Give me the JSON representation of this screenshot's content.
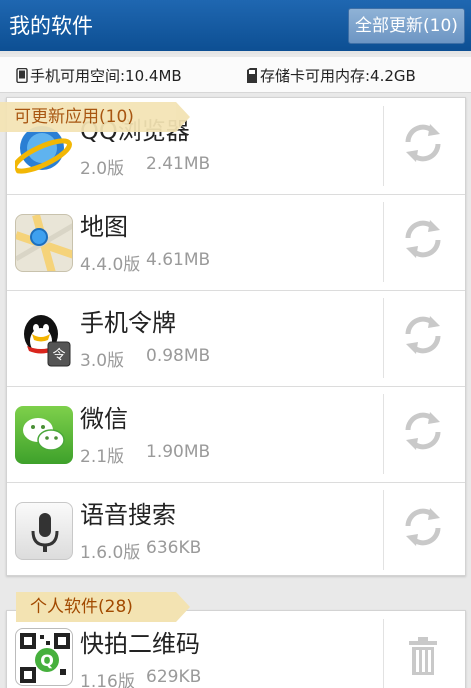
{
  "header": {
    "title": "我的软件",
    "update_all_label": "全部更新(10)"
  },
  "storage": {
    "phone": "手机可用空间:10.4MB",
    "sd": "存储卡可用内存:4.2GB"
  },
  "sections": [
    {
      "label": "可更新应用(10)"
    },
    {
      "label": "个人软件(28)"
    }
  ],
  "updates": [
    {
      "name": "QQ浏览器",
      "version": "2.0版",
      "size": "2.41MB",
      "icon": "qq-browser-icon"
    },
    {
      "name": "地图",
      "version": "4.4.0版",
      "size": "4.61MB",
      "icon": "maps-icon"
    },
    {
      "name": "手机令牌",
      "version": "3.0版",
      "size": "0.98MB",
      "icon": "token-icon"
    },
    {
      "name": "微信",
      "version": "2.1版",
      "size": "1.90MB",
      "icon": "wechat-icon"
    },
    {
      "name": "语音搜索",
      "version": "1.6.0版",
      "size": "636KB",
      "icon": "voice-search-icon"
    }
  ],
  "personal": [
    {
      "name": "快拍二维码",
      "version": "1.16版",
      "size": "629KB",
      "icon": "qrcode-icon"
    }
  ],
  "colors": {
    "header_bg": "#1559a3",
    "tag_bg": "#f3e3b2",
    "tag_text": "#a24a00",
    "muted": "#9a9a9a"
  }
}
